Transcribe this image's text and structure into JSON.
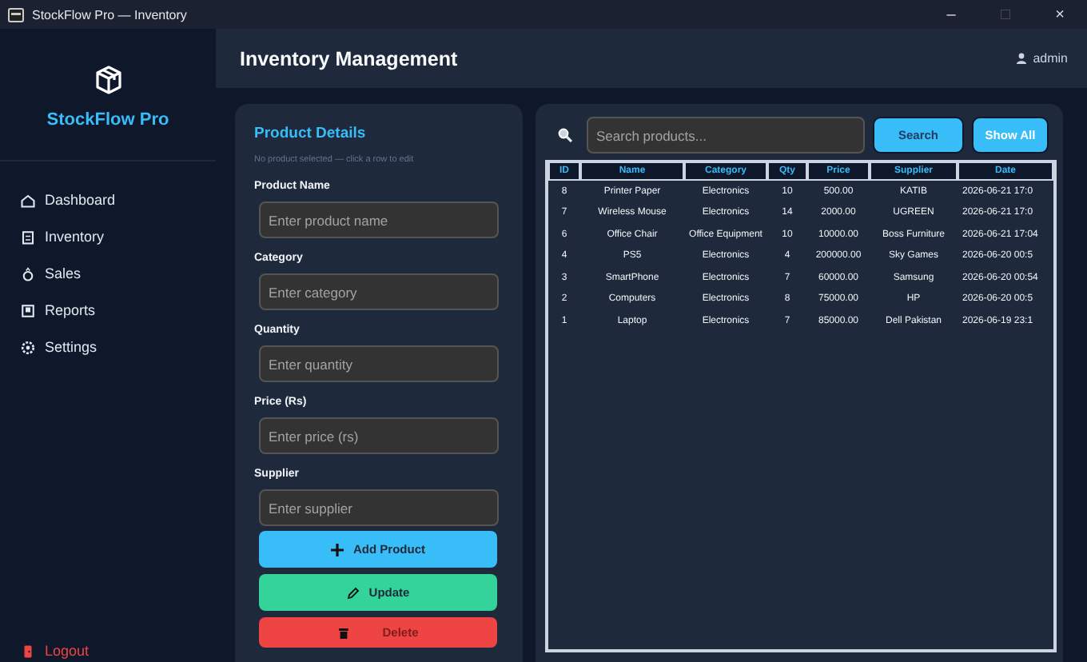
{
  "window": {
    "title": "StockFlow Pro — Inventory",
    "controls": [
      "–",
      "□",
      "×"
    ]
  },
  "sidebar": {
    "app_name": "StockFlow Pro",
    "items": [
      {
        "label": "Dashboard",
        "kind": "nav"
      },
      {
        "label": "Inventory",
        "kind": "nav"
      },
      {
        "label": "Sales",
        "kind": "nav"
      },
      {
        "label": "Reports",
        "kind": "nav"
      },
      {
        "label": "Settings",
        "kind": "nav"
      },
      {
        "label": "Logout",
        "kind": "danger"
      }
    ]
  },
  "header": {
    "title": "Inventory Management",
    "user": "admin"
  },
  "form": {
    "title": "Product Details",
    "hint": "No product selected — click a row to edit",
    "fields": [
      {
        "label": "Product Name",
        "placeholder": "Enter product name"
      },
      {
        "label": "Category",
        "placeholder": "Enter category"
      },
      {
        "label": "Quantity",
        "placeholder": "Enter quantity"
      },
      {
        "label": "Price (Rs)",
        "placeholder": "Enter price (rs)"
      },
      {
        "label": "Supplier",
        "placeholder": "Enter supplier"
      }
    ],
    "buttons": [
      {
        "label": "Add Product",
        "kind": "add"
      },
      {
        "label": "Update",
        "kind": "update"
      },
      {
        "label": "Delete",
        "kind": "delete"
      }
    ]
  },
  "search": {
    "placeholder": "Search products...",
    "buttons": [
      "Search",
      "Show All"
    ]
  },
  "table": {
    "columns": [
      "ID",
      "Name",
      "Category",
      "Qty",
      "Price",
      "Supplier",
      "Date"
    ],
    "rows": [
      [
        "8",
        "Printer Paper",
        "Electronics",
        "10",
        "500.00",
        "KATIB",
        "2026-06-21 17:0"
      ],
      [
        "7",
        "Wireless Mouse",
        "Electronics",
        "14",
        "2000.00",
        "UGREEN",
        "2026-06-21 17:0"
      ],
      [
        "6",
        "Office Chair",
        "Office Equipment",
        "10",
        "10000.00",
        "Boss Furniture",
        "2026-06-21 17:04"
      ],
      [
        "4",
        "PS5",
        "Electronics",
        "4",
        "200000.00",
        "Sky Games",
        "2026-06-20 00:5"
      ],
      [
        "3",
        "SmartPhone",
        "Electronics",
        "7",
        "60000.00",
        "Samsung",
        "2026-06-20 00:54"
      ],
      [
        "2",
        "Computers",
        "Electronics",
        "8",
        "75000.00",
        "HP",
        "2026-06-20 00:5"
      ],
      [
        "1",
        "Laptop",
        "Electronics",
        "7",
        "85000.00",
        "Dell Pakistan",
        "2026-06-19 23:1"
      ]
    ]
  }
}
